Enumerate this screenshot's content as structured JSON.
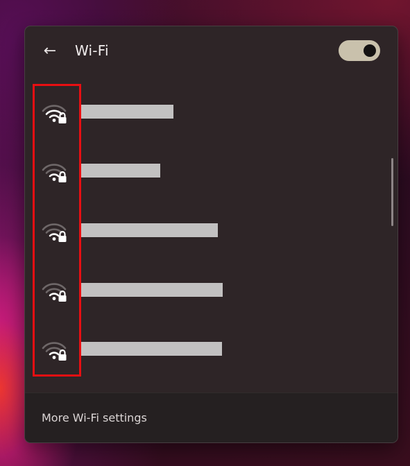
{
  "header": {
    "back_icon": "←",
    "title": "Wi-Fi",
    "wifi_toggle_on": true
  },
  "networks": [
    {
      "name": "",
      "secured": true,
      "signal_icon": "wifi-lock-icon"
    },
    {
      "name": "",
      "secured": true,
      "signal_icon": "wifi-lock-icon"
    },
    {
      "name": "",
      "secured": true,
      "signal_icon": "wifi-lock-icon"
    },
    {
      "name": "",
      "secured": true,
      "signal_icon": "wifi-lock-icon"
    },
    {
      "name": "",
      "secured": true,
      "signal_icon": "wifi-lock-icon"
    }
  ],
  "footer": {
    "link_label": "More Wi-Fi settings"
  },
  "colors": {
    "panel_bg": "#2e2527",
    "toggle_bg": "#c9c1ac",
    "highlight": "#e80f12",
    "redaction": "#c2c1c1"
  }
}
